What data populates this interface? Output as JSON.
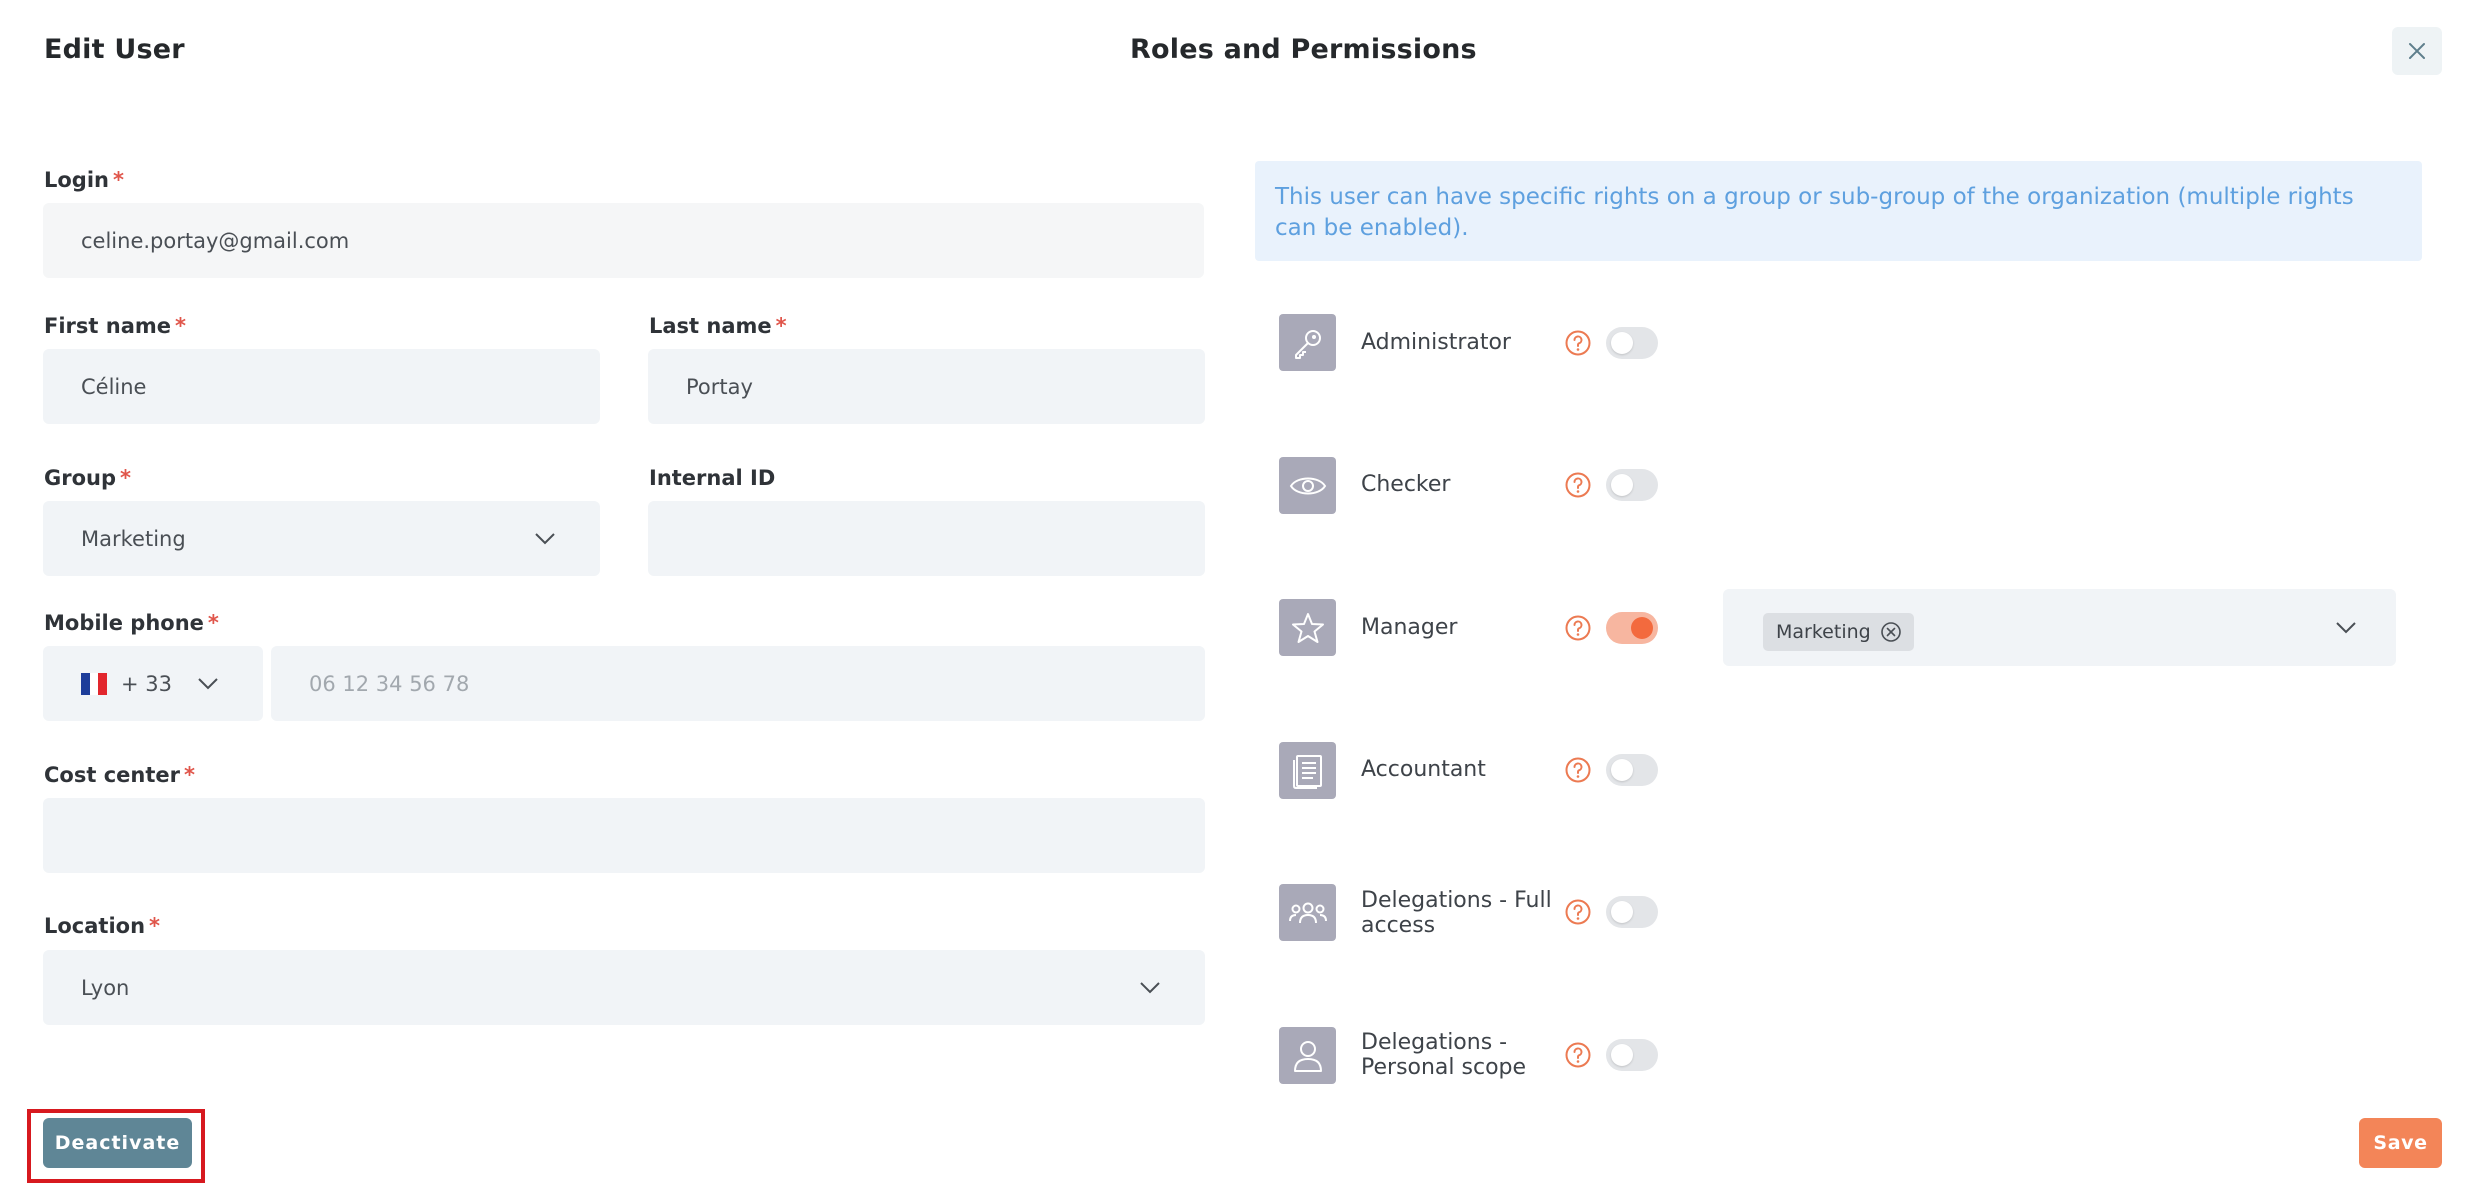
{
  "header": {
    "left_title": "Edit User",
    "center_title": "Roles and Permissions",
    "close_icon": "close-icon"
  },
  "form": {
    "login": {
      "label": "Login",
      "required": "*",
      "value": "celine.portay@gmail.com"
    },
    "first_name": {
      "label": "First name",
      "required": "*",
      "value": "Céline"
    },
    "last_name": {
      "label": "Last name",
      "required": "*",
      "value": "Portay"
    },
    "group": {
      "label": "Group",
      "required": "*",
      "value": "Marketing"
    },
    "internal_id": {
      "label": "Internal ID",
      "value": ""
    },
    "mobile_phone": {
      "label": "Mobile phone",
      "required": "*",
      "country_code": "+ 33",
      "flag": "france-flag-icon",
      "placeholder": "06 12 34 56 78"
    },
    "cost_center": {
      "label": "Cost center",
      "required": "*",
      "value": ""
    },
    "location": {
      "label": "Location",
      "required": "*",
      "value": "Lyon"
    }
  },
  "roles": {
    "info": "This user can have specific rights on a group or sub-group of the organization (multiple rights can be enabled).",
    "items": [
      {
        "label": "Administrator",
        "icon": "key-icon",
        "enabled": false
      },
      {
        "label": "Checker",
        "icon": "eye-icon",
        "enabled": false
      },
      {
        "label": "Manager",
        "icon": "star-icon",
        "enabled": true,
        "scope": [
          "Marketing"
        ]
      },
      {
        "label": "Accountant",
        "icon": "ledger-icon",
        "enabled": false
      },
      {
        "label_line1": "Delegations - Full",
        "label_line2": "access",
        "icon": "group-icon",
        "enabled": false
      },
      {
        "label_line1": "Delegations -",
        "label_line2": "Personal scope",
        "icon": "person-icon",
        "enabled": false
      }
    ]
  },
  "footer": {
    "deactivate_label": "Deactivate",
    "save_label": "Save"
  },
  "colors": {
    "accent": "#f36a3e",
    "deactivate": "#5f8696",
    "save": "#f38558",
    "info_text": "#5ea0df",
    "highlight": "#d7191f"
  }
}
